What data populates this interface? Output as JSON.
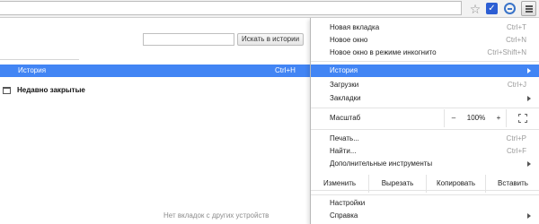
{
  "toolbar": {
    "star_icon": "star-icon",
    "extension_check_icon": "check-icon",
    "extension_sync_icon": "sync-icon",
    "menu_icon": "hamburger-menu-icon"
  },
  "history_page": {
    "search_placeholder": "",
    "search_button": "Искать в истории",
    "row_label": "История",
    "row_shortcut": "Ctrl+H",
    "recently_closed": "Недавно закрытые",
    "no_tabs": "Нет вкладок с других устройств"
  },
  "menu": {
    "new_tab": {
      "label": "Новая вкладка",
      "shortcut": "Ctrl+T"
    },
    "new_window": {
      "label": "Новое окно",
      "shortcut": "Ctrl+N"
    },
    "incognito": {
      "label": "Новое окно в режиме инкогнито",
      "shortcut": "Ctrl+Shift+N"
    },
    "history": {
      "label": "История"
    },
    "downloads": {
      "label": "Загрузки",
      "shortcut": "Ctrl+J"
    },
    "bookmarks": {
      "label": "Закладки"
    },
    "zoom": {
      "label": "Масштаб",
      "minus": "–",
      "value": "100%",
      "plus": "+"
    },
    "print": {
      "label": "Печать...",
      "shortcut": "Ctrl+P"
    },
    "find": {
      "label": "Найти...",
      "shortcut": "Ctrl+F"
    },
    "more_tools": {
      "label": "Дополнительные инструменты"
    },
    "edit": {
      "label": "Изменить",
      "cut": "Вырезать",
      "copy": "Копировать",
      "paste": "Вставить"
    },
    "settings": {
      "label": "Настройки"
    },
    "help": {
      "label": "Справка"
    }
  },
  "colors": {
    "highlight": "#4285f4",
    "toolbar_bg": "#f2f2f2"
  }
}
